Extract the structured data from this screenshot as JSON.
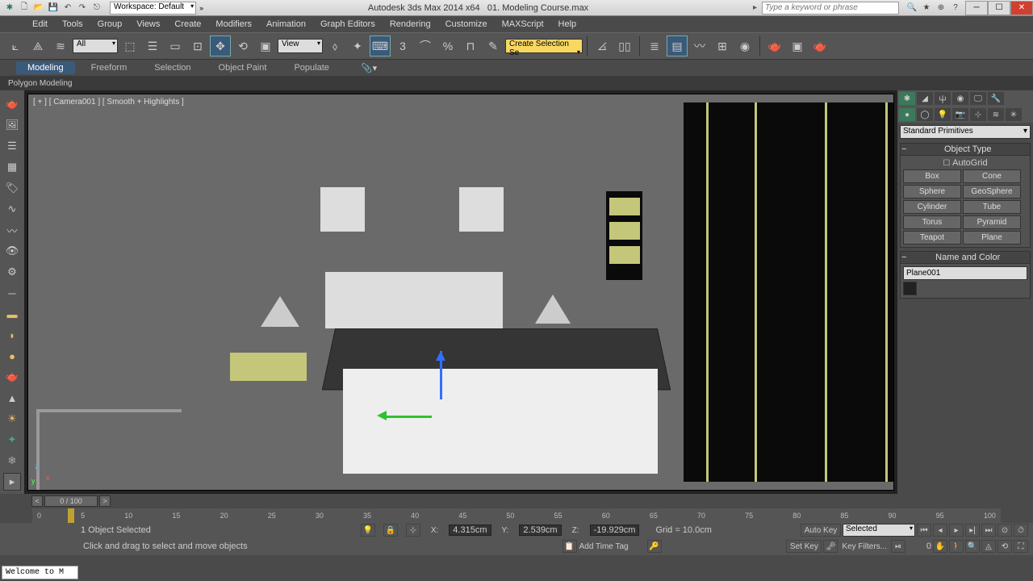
{
  "title": {
    "app": "Autodesk 3ds Max 2014 x64",
    "file": "01. Modeling Course.max",
    "workspace": "Workspace: Default",
    "search_placeholder": "Type a keyword or phrase"
  },
  "menu": [
    "Edit",
    "Tools",
    "Group",
    "Views",
    "Create",
    "Modifiers",
    "Animation",
    "Graph Editors",
    "Rendering",
    "Customize",
    "MAXScript",
    "Help"
  ],
  "toolbar": {
    "sel_filter": "All",
    "ref_coord": "View",
    "named_sel": "Create Selection Se"
  },
  "ribbon": {
    "tabs": [
      "Modeling",
      "Freeform",
      "Selection",
      "Object Paint",
      "Populate"
    ],
    "active": 0,
    "sub": "Polygon Modeling"
  },
  "viewport": {
    "label": "[ + ] [ Camera001 ] [ Smooth + Highlights ]"
  },
  "right": {
    "category": "Standard Primitives",
    "object_type_hdr": "Object Type",
    "autogrid": "AutoGrid",
    "primitives": [
      "Box",
      "Cone",
      "Sphere",
      "GeoSphere",
      "Cylinder",
      "Tube",
      "Torus",
      "Pyramid",
      "Teapot",
      "Plane"
    ],
    "name_color_hdr": "Name and Color",
    "obj_name": "Plane001"
  },
  "track": {
    "slider": "0 / 100"
  },
  "timeline_ticks": [
    "0",
    "5",
    "10",
    "15",
    "20",
    "25",
    "30",
    "35",
    "40",
    "45",
    "50",
    "55",
    "60",
    "65",
    "70",
    "75",
    "80",
    "85",
    "90",
    "95",
    "100"
  ],
  "status": {
    "selection": "1 Object Selected",
    "x": "4.315cm",
    "y": "2.539cm",
    "z": "-19.929cm",
    "grid": "Grid = 10.0cm",
    "prompt": "Click and drag to select and move objects",
    "timetag": "Add Time Tag",
    "autokey": "Auto Key",
    "setkey": "Set Key",
    "selected": "Selected",
    "keyfilters": "Key Filters...",
    "frame": "0",
    "welcome": "Welcome to M"
  }
}
